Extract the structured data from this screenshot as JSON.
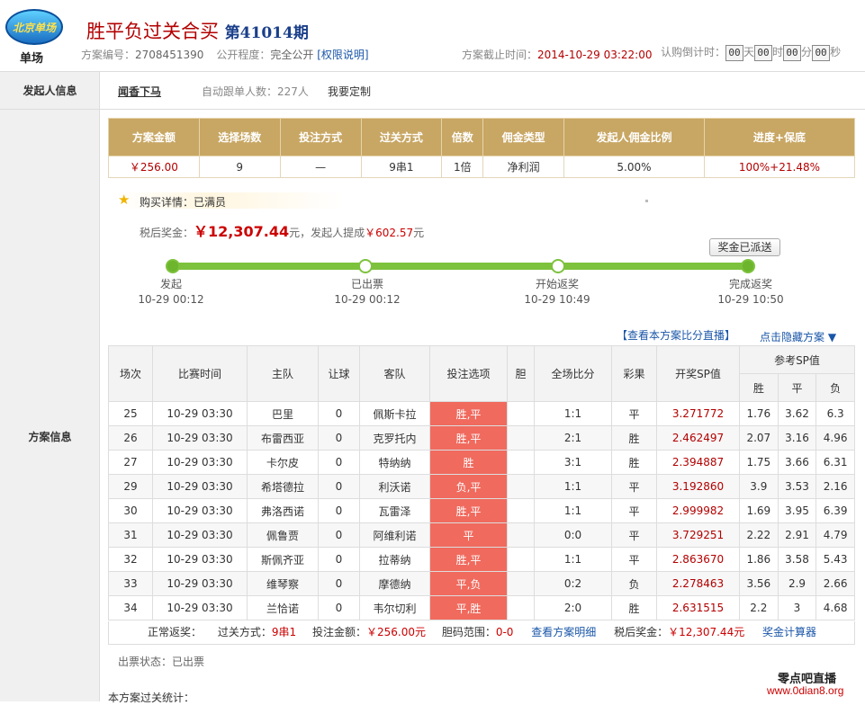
{
  "header": {
    "logo_text": "北京单场",
    "logo_label": "单场",
    "title": "胜平负过关合买",
    "issue": "第41014期",
    "plan_no_label": "方案编号：",
    "plan_no": "2708451390",
    "public_label": "公开程度：",
    "public_value": "完全公开",
    "perm_link": "[权限说明]",
    "deadline_label": "方案截止时间：",
    "deadline": "2014-10-29 03:22:00",
    "countdown_label": "认购倒计时：",
    "countdown": {
      "days": "00",
      "day_unit": "天",
      "hours": "00",
      "hour_unit": "时",
      "minutes": "00",
      "minute_unit": "分",
      "seconds": "00",
      "second_unit": "秒"
    }
  },
  "sidebar": {
    "initiator_label": "发起人信息",
    "plan_label": "方案信息"
  },
  "initiator": {
    "name": "闻香下马",
    "auto_follow": "自动跟单人数：227人",
    "custom": "我要定制"
  },
  "summary": {
    "headers": [
      "方案金额",
      "选择场数",
      "投注方式",
      "过关方式",
      "倍数",
      "佣金类型",
      "发起人佣金比例",
      "进度+保底"
    ],
    "values": [
      "￥256.00",
      "9",
      "—",
      "9串1",
      "1倍",
      "净利润",
      "5.00%",
      "100%+21.48%"
    ]
  },
  "buy": {
    "label": "购买详情：",
    "value": "已满员"
  },
  "prize": {
    "label": "税后奖金：",
    "amount": "￥12,307.44",
    "unit": "元，发起人提成",
    "commission": "￥602.57",
    "commission_unit": "元"
  },
  "sent_button": "奖金已派送",
  "progress": {
    "stages": [
      {
        "name": "发起",
        "time": "10-29 00:12"
      },
      {
        "name": "已出票",
        "time": "10-29 00:12"
      },
      {
        "name": "开始返奖",
        "time": "10-29 10:49"
      },
      {
        "name": "完成返奖",
        "time": "10-29 10:50"
      }
    ]
  },
  "links": {
    "live": "【查看本方案比分直播】",
    "hide": "点击隐藏方案 ▼"
  },
  "table": {
    "headers": [
      "场次",
      "比赛时间",
      "主队",
      "让球",
      "客队",
      "投注选项",
      "胆",
      "全场比分",
      "彩果",
      "开奖SP值"
    ],
    "ref_header": "参考SP值",
    "ref_sub": [
      "胜",
      "平",
      "负"
    ],
    "rows": [
      [
        "25",
        "10-29 03:30",
        "巴里",
        "0",
        "佩斯卡拉",
        "胜,平",
        "",
        "1:1",
        "平",
        "3.271772",
        "1.76",
        "3.62",
        "6.3"
      ],
      [
        "26",
        "10-29 03:30",
        "布雷西亚",
        "0",
        "克罗托内",
        "胜,平",
        "",
        "2:1",
        "胜",
        "2.462497",
        "2.07",
        "3.16",
        "4.96"
      ],
      [
        "27",
        "10-29 03:30",
        "卡尔皮",
        "0",
        "特纳纳",
        "胜",
        "",
        "3:1",
        "胜",
        "2.394887",
        "1.75",
        "3.66",
        "6.31"
      ],
      [
        "29",
        "10-29 03:30",
        "希塔德拉",
        "0",
        "利沃诺",
        "负,平",
        "",
        "1:1",
        "平",
        "3.192860",
        "3.9",
        "3.53",
        "2.16"
      ],
      [
        "30",
        "10-29 03:30",
        "弗洛西诺",
        "0",
        "瓦雷泽",
        "胜,平",
        "",
        "1:1",
        "平",
        "2.999982",
        "1.69",
        "3.95",
        "6.39"
      ],
      [
        "31",
        "10-29 03:30",
        "佩鲁贾",
        "0",
        "阿维利诺",
        "平",
        "",
        "0:0",
        "平",
        "3.729251",
        "2.22",
        "2.91",
        "4.79"
      ],
      [
        "32",
        "10-29 03:30",
        "斯佩齐亚",
        "0",
        "拉蒂纳",
        "胜,平",
        "",
        "1:1",
        "平",
        "2.863670",
        "1.86",
        "3.58",
        "5.43"
      ],
      [
        "33",
        "10-29 03:30",
        "维琴察",
        "0",
        "摩德纳",
        "平,负",
        "",
        "0:2",
        "负",
        "2.278463",
        "3.56",
        "2.9",
        "2.66"
      ],
      [
        "34",
        "10-29 03:30",
        "兰恰诺",
        "0",
        "韦尔切利",
        "平,胜",
        "",
        "2:0",
        "胜",
        "2.631515",
        "2.2",
        "3",
        "4.68"
      ]
    ]
  },
  "footer": {
    "normal": "正常返奖：",
    "pass_label": "过关方式：",
    "pass_value": "9串1",
    "amount_label": "投注金额：",
    "amount_value": "￥256.00元",
    "range_label": "胆码范围：",
    "range_value": "0-0",
    "detail_link": "查看方案明细",
    "tax_label": "税后奖金：",
    "tax_value": "￥12,307.44元",
    "calc_link": "奖金计算器"
  },
  "ticket_status": "出票状态：已出票",
  "stats_label": "本方案过关统计：",
  "watermark": {
    "name": "零点吧直播",
    "url": "www.0dian8.org"
  }
}
